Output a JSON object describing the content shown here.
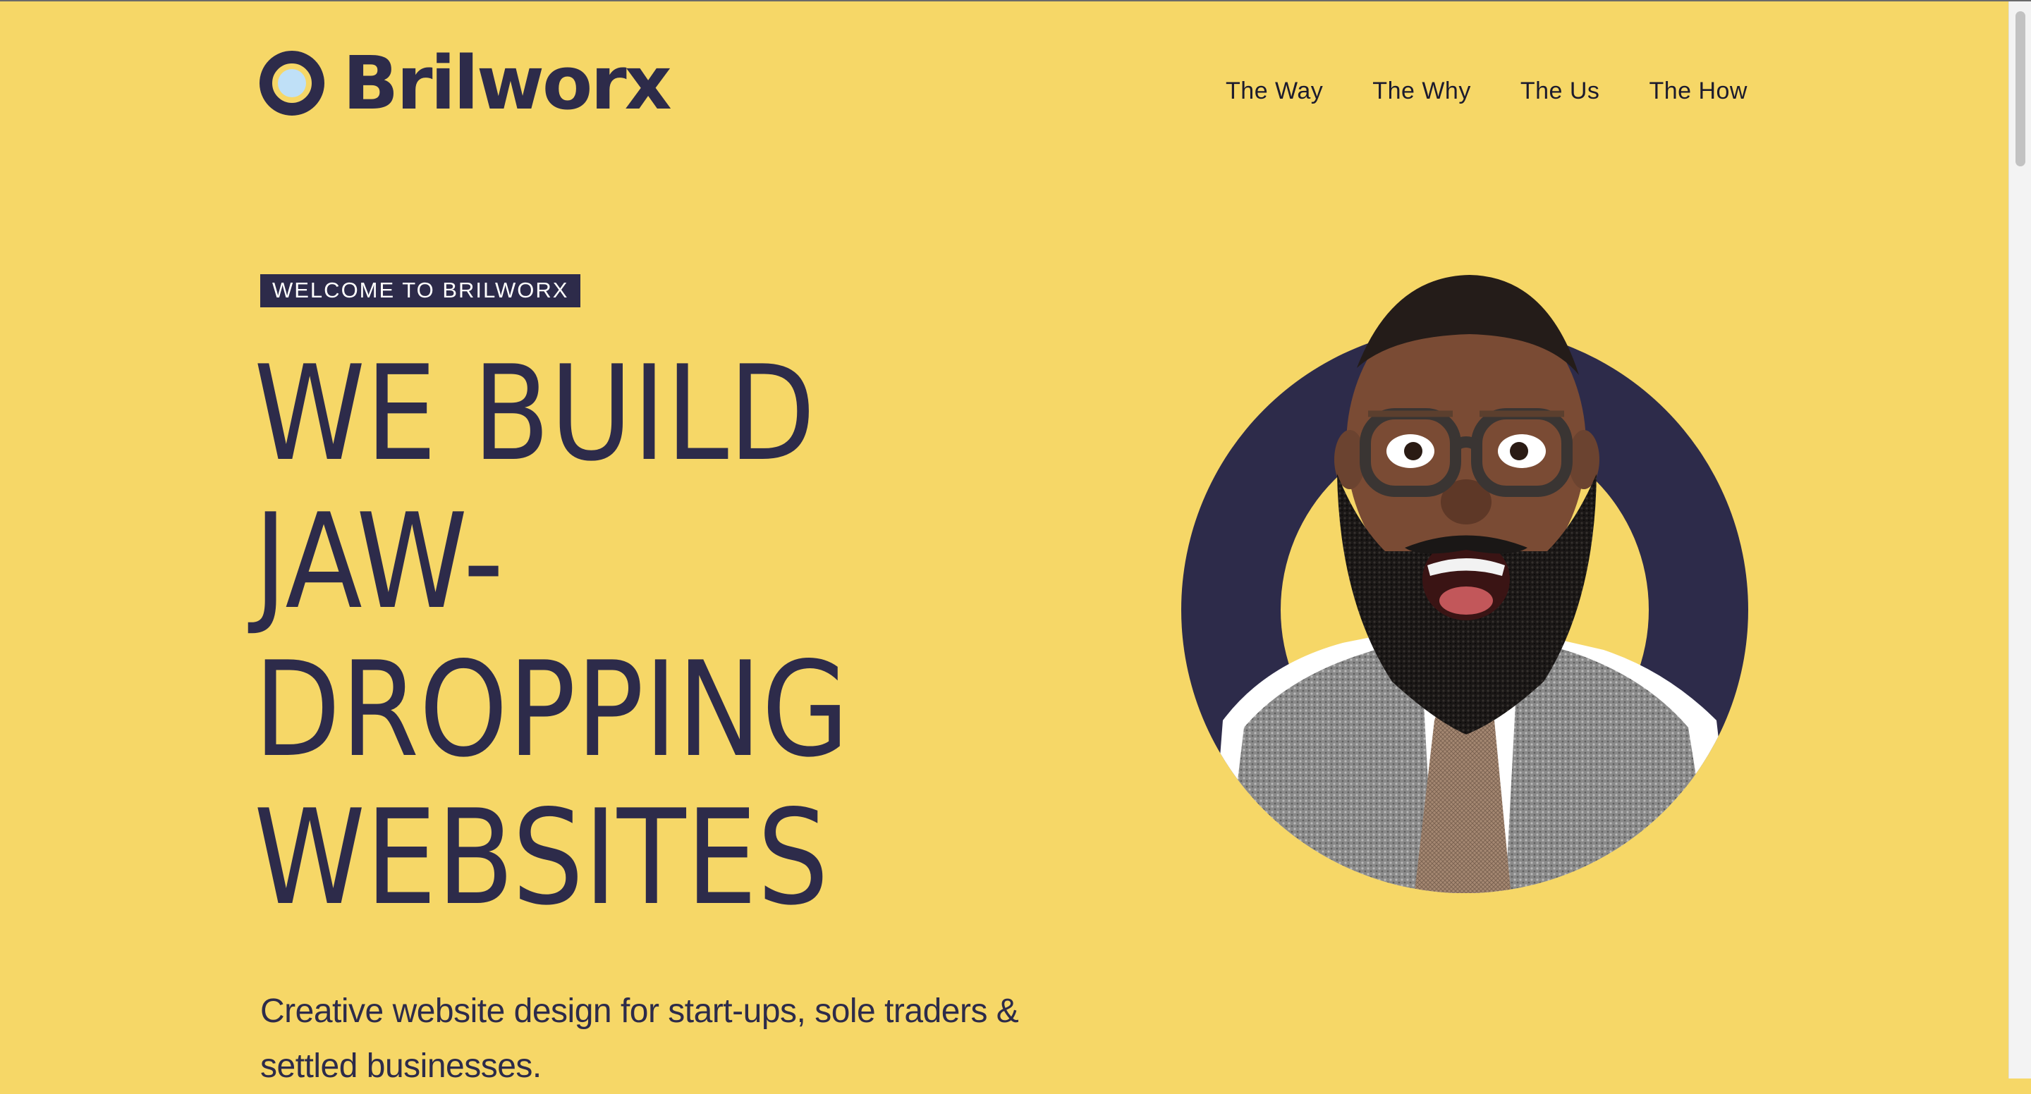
{
  "brand": {
    "name": "Brilworx"
  },
  "nav": {
    "items": [
      {
        "label": "The Way"
      },
      {
        "label": "The Why"
      },
      {
        "label": "The Us"
      },
      {
        "label": "The How"
      }
    ]
  },
  "hero": {
    "badge": "WELCOME TO BRILWORX",
    "headline_lines": [
      "WE BUILD",
      "JAW-",
      "DROPPING",
      "WEBSITES"
    ],
    "subtitle": "Creative website design for start-ups, sole traders & settled businesses."
  },
  "colors": {
    "background": "#f6d767",
    "navy": "#2d2b4a",
    "logo_accent": "#bfe0f7",
    "badge_text": "#ffffff"
  },
  "icons": {
    "logo_mark": "ring-logo-icon",
    "hero_image": "excited-man-portrait"
  }
}
